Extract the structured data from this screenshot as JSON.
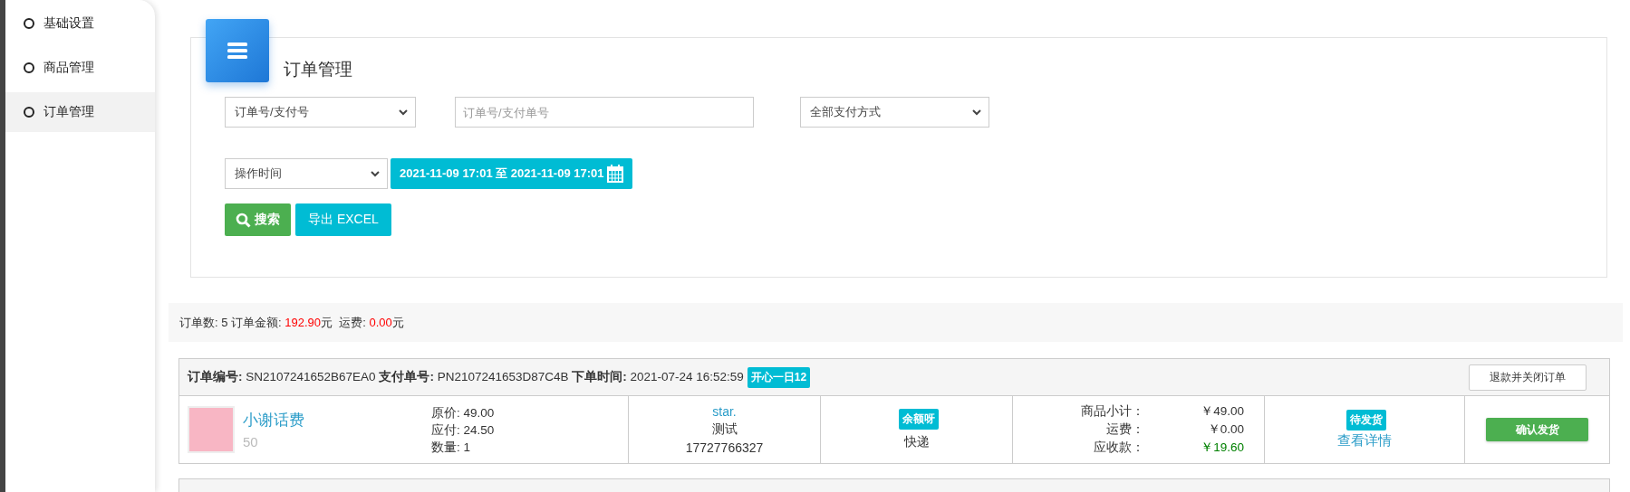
{
  "sidebar": {
    "items": [
      {
        "label": "基础设置",
        "selected": false
      },
      {
        "label": "商品管理",
        "selected": false
      },
      {
        "label": "订单管理",
        "selected": true
      }
    ]
  },
  "panel": {
    "title": "订单管理",
    "filters": [
      {
        "kind": "select",
        "value": "订单号/支付号"
      },
      {
        "kind": "input",
        "placeholder": "订单号/支付单号"
      },
      {
        "kind": "select",
        "value": "全部支付方式"
      }
    ],
    "time_select": {
      "value": "操作时间"
    },
    "date_range": "2021-11-09 17:01 至 2021-11-09 17:01",
    "search_button": "搜索",
    "export_button": "导出 EXCEL"
  },
  "summary": {
    "count_label": "订单数:",
    "count": "5",
    "amount_label": "订单金额:",
    "amount": "192.90",
    "unit": "元",
    "freight_label": "运费:",
    "freight": "0.00",
    "freight_unit": "元"
  },
  "orders": [
    {
      "order_no_label": "订单编号:",
      "order_no": "SN2107241652B67EA0",
      "pay_no_label": "支付单号:",
      "pay_no": "PN2107241653D87C4B",
      "time_label": "下单时间:",
      "time": "2021-07-24 16:52:59",
      "tag": "开心一日12",
      "close_button": "退款并关闭订单",
      "product": {
        "name": "小谢话费",
        "sub": "50"
      },
      "prices": [
        "原价: 49.00",
        "应付: 24.50",
        "数量: 1"
      ],
      "buyer": {
        "name": "star.",
        "note": "测试",
        "phone": "17727766327"
      },
      "payment_tag": "余额呀",
      "delivery": "快递",
      "amounts": [
        {
          "label": "商品小计：",
          "value": "￥49.00",
          "kind": "normal"
        },
        {
          "label": "运费：",
          "value": "￥0.00",
          "kind": "normal"
        },
        {
          "label": "应收款：",
          "value": "￥19.60",
          "kind": "received"
        }
      ],
      "status": "待发货",
      "detail_link": "查看详情",
      "action_button": "确认发货"
    }
  ]
}
